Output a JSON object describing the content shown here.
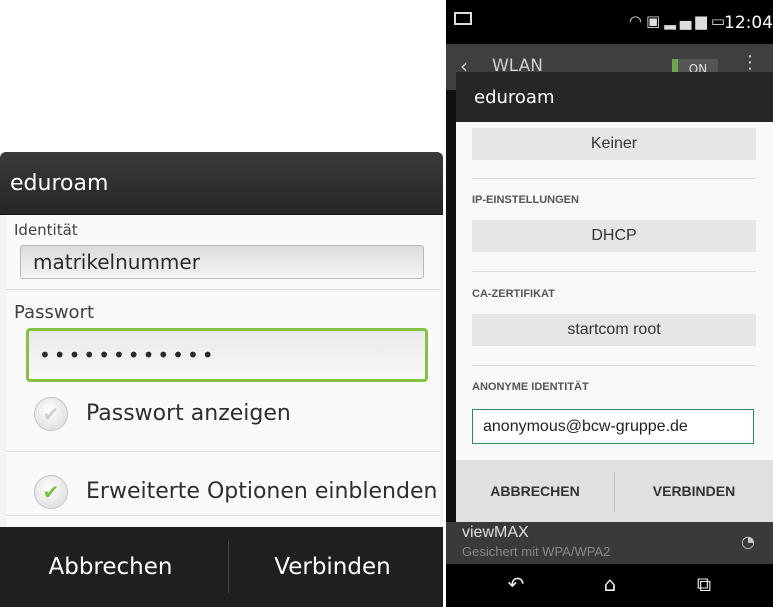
{
  "left_dialog": {
    "title": "eduroam",
    "identity_label": "Identität",
    "identity_value": "matrikelnummer",
    "password_label": "Passwort",
    "password_value": "••••••••••••",
    "show_password_label": "Passwort anzeigen",
    "advanced_options_label": "Erweiterte Optionen einblenden",
    "cancel_label": "Abbrechen",
    "connect_label": "Verbinden",
    "accent_color": "#82c341"
  },
  "phone": {
    "status_time": "12:04",
    "wlan_title": "WLAN",
    "wlan_toggle": "ON",
    "dialog": {
      "title": "eduroam",
      "phase2_value": "Keiner",
      "ip_settings_label": "IP-EINSTELLUNGEN",
      "ip_settings_value": "DHCP",
      "ca_cert_label": "CA-ZERTIFIKAT",
      "ca_cert_value": "startcom root",
      "anon_identity_label": "ANONYME IDENTITÄT",
      "anon_identity_value": "anonymous@bcw-gruppe.de",
      "cancel_label": "ABBRECHEN",
      "connect_label": "VERBINDEN"
    },
    "network_below": {
      "name": "viewMAX",
      "status": "Gesichert mit WPA/WPA2"
    }
  }
}
